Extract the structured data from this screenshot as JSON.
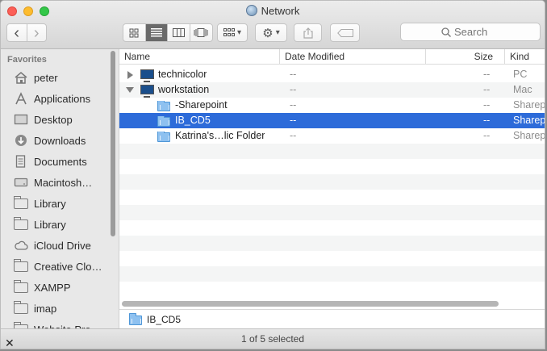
{
  "window": {
    "title": "Network",
    "globe_icon": "network-globe-icon"
  },
  "toolbar": {
    "back_glyph": "‹",
    "forward_glyph": "›",
    "view_icon_glyph": "⊞",
    "arrange_glyph": "▾",
    "action_glyph": "⚙",
    "search_placeholder": "Search"
  },
  "sidebar": {
    "header": "Favorites",
    "items": [
      {
        "label": "peter",
        "icon": "home-icon"
      },
      {
        "label": "Applications",
        "icon": "applications-icon"
      },
      {
        "label": "Desktop",
        "icon": "desktop-icon"
      },
      {
        "label": "Downloads",
        "icon": "downloads-icon"
      },
      {
        "label": "Documents",
        "icon": "documents-icon"
      },
      {
        "label": "Macintosh…",
        "icon": "hard-drive-icon"
      },
      {
        "label": "Library",
        "icon": "folder-icon"
      },
      {
        "label": "Library",
        "icon": "folder-icon"
      },
      {
        "label": "iCloud Drive",
        "icon": "cloud-icon"
      },
      {
        "label": "Creative Clo…",
        "icon": "folder-icon"
      },
      {
        "label": "XAMPP",
        "icon": "folder-icon"
      },
      {
        "label": "imap",
        "icon": "folder-icon"
      },
      {
        "label": "Website Pro…",
        "icon": "folder-icon"
      }
    ]
  },
  "columns": {
    "name": "Name",
    "date_modified": "Date Modified",
    "size": "Size",
    "kind": "Kind"
  },
  "rows": [
    {
      "name": "technicolor",
      "date": "--",
      "size": "--",
      "kind": "PC",
      "icon": "computer-icon"
    },
    {
      "name": "workstation",
      "date": "--",
      "size": "--",
      "kind": "Mac",
      "icon": "computer-icon"
    },
    {
      "name": "-Sharepoint",
      "date": "--",
      "size": "--",
      "kind": "Sharep",
      "icon": "shared-folder-icon"
    },
    {
      "name": "IB_CD5",
      "date": "--",
      "size": "--",
      "kind": "Sharep",
      "icon": "shared-folder-icon"
    },
    {
      "name": "Katrina's…lic Folder",
      "date": "--",
      "size": "--",
      "kind": "Sharep",
      "icon": "shared-folder-icon"
    }
  ],
  "pathbar": {
    "label": "IB_CD5"
  },
  "status": {
    "text": "1 of 5 selected"
  }
}
